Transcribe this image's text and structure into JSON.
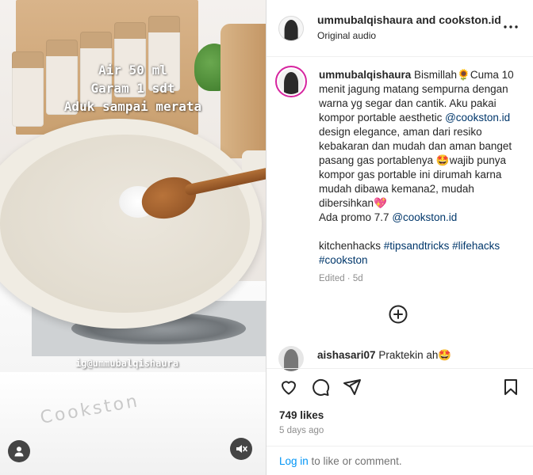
{
  "video": {
    "overlay_lines": [
      "Air 50 ml",
      "Garam 1 sdt",
      "Aduk sampai merata"
    ],
    "watermark": "ig@ummubalqishaura",
    "brand": "Cookston",
    "user_icon": "user-icon",
    "mute_icon": "speaker-muted-icon"
  },
  "header": {
    "title": "ummubalqishaura and cookston.id",
    "subtitle": "Original audio",
    "more_icon": "more-horizontal-icon"
  },
  "caption": {
    "username": "ummubalqishaura",
    "text_1": "Bismillah",
    "emoji_1": "🌻",
    "text_2": "Cuma 10 menit jagung matang sempurna dengan warna yg segar dan cantik. Aku pakai kompor portable aesthetic ",
    "mention_1": "@cookston.id",
    "text_3": " design elegance, aman dari resiko kebakaran dan mudah dan aman banget pasang gas portablenya",
    "emoji_2": "🤩",
    "text_4": "wajib punya kompor gas portable ini dirumah karna mudah dibawa kemana2, mudah dibersihkan",
    "emoji_3": "💖",
    "promo_text": "Ada promo 7.7 ",
    "mention_2": "@cookston.id",
    "tags_plain": "kitchenhacks ",
    "tags": [
      "#tipsandtricks",
      "#lifehacks",
      "#cookston"
    ],
    "edited": "Edited · 5d"
  },
  "comments": [
    {
      "username": "aishasari07",
      "text": "Praktekin ah",
      "emoji": "🤩"
    }
  ],
  "actions": {
    "icons": [
      "heart-icon",
      "comment-icon",
      "share-icon",
      "bookmark-icon"
    ]
  },
  "likes": "749 likes",
  "date": "5 days ago",
  "login": {
    "link": "Log in",
    "rest": " to like or comment."
  },
  "colors": {
    "accent": "#0095f6",
    "link": "#00376b",
    "ring": "#d6249f",
    "muted": "#8e8e8e"
  }
}
